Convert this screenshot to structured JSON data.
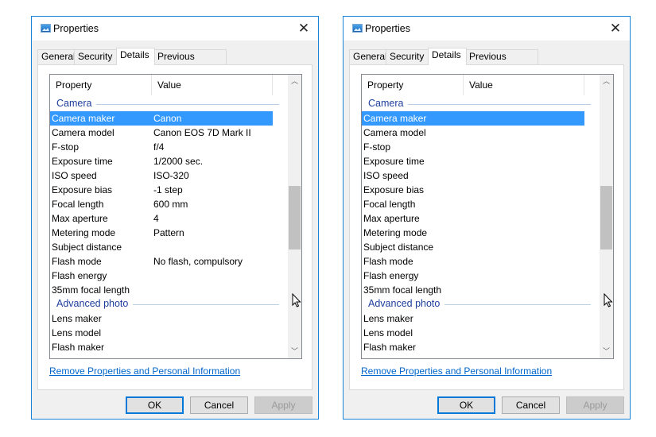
{
  "dialogs": [
    {
      "title": "Properties",
      "close_label": "✕",
      "tabs": [
        {
          "label": "General",
          "active": false
        },
        {
          "label": "Security",
          "active": false
        },
        {
          "label": "Details",
          "active": true
        },
        {
          "label": "Previous Versions",
          "active": false
        }
      ],
      "columns": {
        "property": "Property",
        "value": "Value"
      },
      "groups": [
        {
          "name": "Camera",
          "rows": [
            {
              "property": "Camera maker",
              "value": "Canon",
              "selected": true
            },
            {
              "property": "Camera model",
              "value": "Canon EOS 7D Mark II"
            },
            {
              "property": "F-stop",
              "value": "f/4"
            },
            {
              "property": "Exposure time",
              "value": "1/2000 sec."
            },
            {
              "property": "ISO speed",
              "value": "ISO-320"
            },
            {
              "property": "Exposure bias",
              "value": "-1 step"
            },
            {
              "property": "Focal length",
              "value": "600 mm"
            },
            {
              "property": "Max aperture",
              "value": "4"
            },
            {
              "property": "Metering mode",
              "value": "Pattern"
            },
            {
              "property": "Subject distance",
              "value": ""
            },
            {
              "property": "Flash mode",
              "value": "No flash, compulsory"
            },
            {
              "property": "Flash energy",
              "value": ""
            },
            {
              "property": "35mm focal length",
              "value": ""
            }
          ]
        },
        {
          "name": "Advanced photo",
          "rows": [
            {
              "property": "Lens maker",
              "value": ""
            },
            {
              "property": "Lens model",
              "value": ""
            },
            {
              "property": "Flash maker",
              "value": ""
            }
          ]
        }
      ],
      "scroll_position_fraction": 0.38,
      "scroll_visible_fraction": 0.25,
      "remove_link": "Remove Properties and Personal Information",
      "buttons": {
        "ok": "OK",
        "cancel": "Cancel",
        "apply": "Apply",
        "apply_enabled": false
      }
    },
    {
      "title": "Properties",
      "close_label": "✕",
      "tabs": [
        {
          "label": "General",
          "active": false
        },
        {
          "label": "Security",
          "active": false
        },
        {
          "label": "Details",
          "active": true
        },
        {
          "label": "Previous Versions",
          "active": false
        }
      ],
      "columns": {
        "property": "Property",
        "value": "Value"
      },
      "groups": [
        {
          "name": "Camera",
          "rows": [
            {
              "property": "Camera maker",
              "value": "",
              "selected": true
            },
            {
              "property": "Camera model",
              "value": ""
            },
            {
              "property": "F-stop",
              "value": ""
            },
            {
              "property": "Exposure time",
              "value": ""
            },
            {
              "property": "ISO speed",
              "value": ""
            },
            {
              "property": "Exposure bias",
              "value": ""
            },
            {
              "property": "Focal length",
              "value": ""
            },
            {
              "property": "Max aperture",
              "value": ""
            },
            {
              "property": "Metering mode",
              "value": ""
            },
            {
              "property": "Subject distance",
              "value": ""
            },
            {
              "property": "Flash mode",
              "value": ""
            },
            {
              "property": "Flash energy",
              "value": ""
            },
            {
              "property": "35mm focal length",
              "value": ""
            }
          ]
        },
        {
          "name": "Advanced photo",
          "rows": [
            {
              "property": "Lens maker",
              "value": ""
            },
            {
              "property": "Lens model",
              "value": ""
            },
            {
              "property": "Flash maker",
              "value": ""
            }
          ]
        }
      ],
      "scroll_position_fraction": 0.38,
      "scroll_visible_fraction": 0.25,
      "remove_link": "Remove Properties and Personal Information",
      "buttons": {
        "ok": "OK",
        "cancel": "Cancel",
        "apply": "Apply",
        "apply_enabled": false
      }
    }
  ],
  "icons": {
    "title": "image-file-icon",
    "close": "close-icon",
    "scroll_up": "chevron-up-icon",
    "scroll_down": "chevron-down-icon",
    "cursor": "mouse-pointer-icon"
  }
}
